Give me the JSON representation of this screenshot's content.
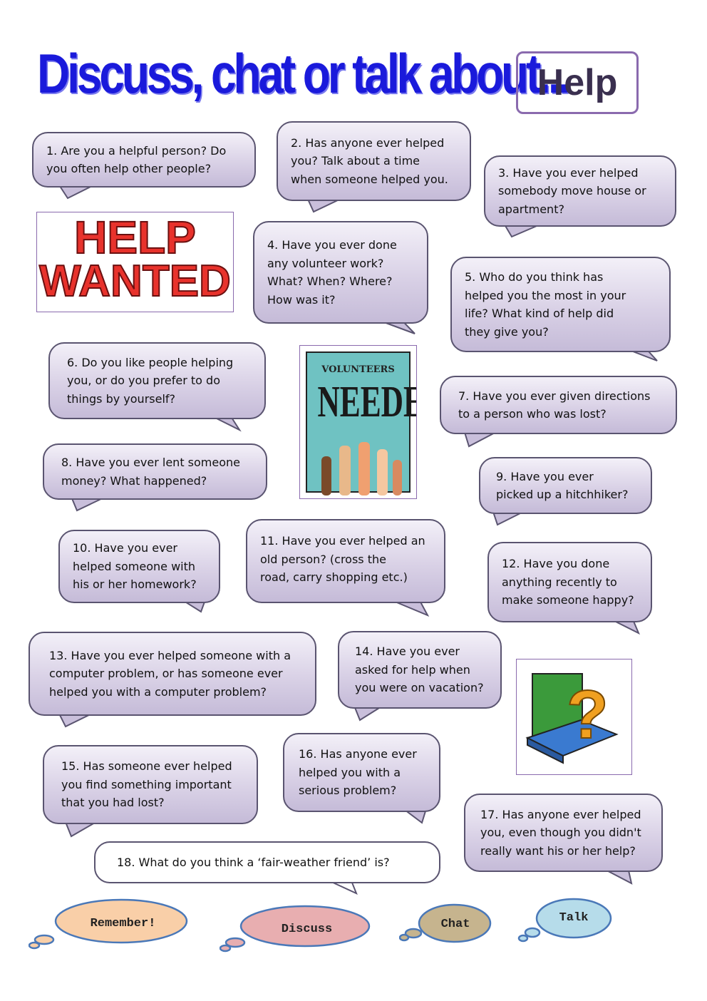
{
  "title": "Discuss, chat or talk about...",
  "topic": "Help",
  "images": {
    "help_wanted": {
      "line1": "HELP",
      "line2": "WANTED"
    },
    "volunteers": {
      "line1": "VOLUNTEERS",
      "line2": "NEEDED"
    },
    "book": {
      "symbol": "?"
    }
  },
  "questions": [
    "1. Are you a helpful person? Do\nyou often help other people?",
    "2. Has anyone ever helped\nyou? Talk about a time\nwhen someone helped you.",
    "3. Have you ever helped\nsomebody move house or\napartment?",
    "4. Have you ever done\nany volunteer work?\nWhat? When? Where?\nHow was it?",
    "5. Who do you think has\nhelped you the most in your\nlife? What kind of help did\nthey give you?",
    "6. Do you like people helping\nyou, or do you prefer to do\nthings by yourself?",
    "7. Have you ever given directions\nto a person who was lost?",
    "8. Have you ever lent someone\nmoney? What happened?",
    "9. Have you ever\npicked up a hitchhiker?",
    "10. Have you ever\nhelped someone with\nhis or her homework?",
    "11. Have you ever helped an\nold person? (cross the\nroad, carry shopping etc.)",
    "12. Have you done\nanything recently to\nmake someone happy?",
    "13. Have you ever helped someone with a\ncomputer problem, or has someone ever\nhelped you with a computer problem?",
    "14. Have you ever\nasked for help when\nyou were on vacation?",
    "15. Has someone ever helped\nyou find something important\nthat you had lost?",
    "16. Has anyone ever\nhelped you with a\nserious problem?",
    "17. Has anyone ever helped\nyou, even though you didn't\nreally want his or her help?",
    "18. What do you think a ‘fair-weather friend’ is?"
  ],
  "clouds": [
    {
      "label": "Remember!",
      "color": "#f9cfa8"
    },
    {
      "label": "Discuss",
      "color": "#e8aeb0"
    },
    {
      "label": "Chat",
      "color": "#c6b48e"
    },
    {
      "label": "Talk",
      "color": "#b6dcea"
    }
  ]
}
